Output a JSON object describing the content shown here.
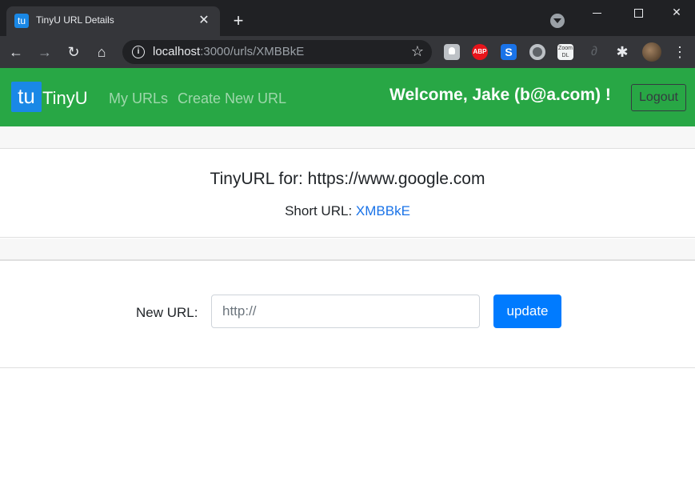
{
  "browser": {
    "tab_title": "TinyU URL Details",
    "tab_favicon_text": "tu",
    "url_host": "localhost",
    "url_path": ":3000/urls/XMBBkE",
    "extension_abp": "ABP",
    "extension_s": "S",
    "extension_zoom": "Zoom DL"
  },
  "navbar": {
    "brand_logo": "tu",
    "brand_text": "TinyU",
    "links": [
      "My URLs",
      "Create New URL"
    ],
    "welcome": "Welcome, Jake (b@a.com) !",
    "logout_label": "Logout",
    "accent_color": "#28a745"
  },
  "details": {
    "heading": "TinyURL for: https://www.google.com",
    "short_label": "Short URL: ",
    "short_value": "XMBBkE"
  },
  "form": {
    "label": "New URL:",
    "placeholder": "http://",
    "value": "",
    "submit_label": "update",
    "button_color": "#007bff"
  }
}
